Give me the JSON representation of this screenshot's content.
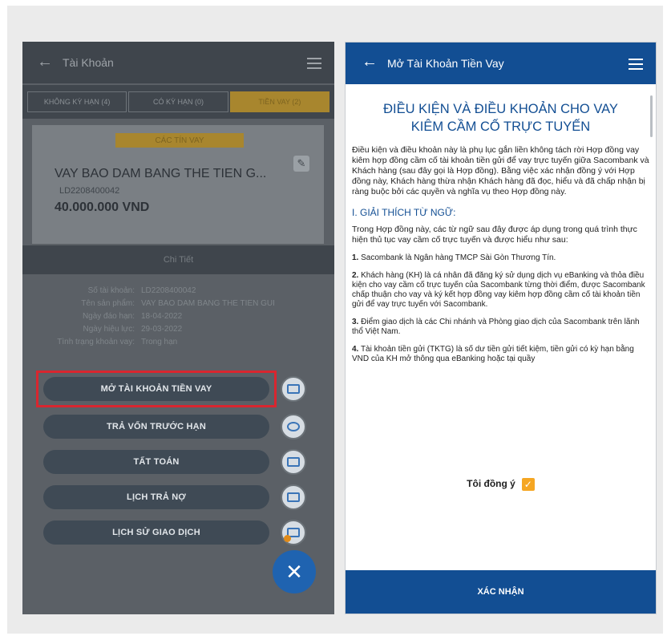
{
  "left": {
    "title": "Tài Khoản",
    "tabs": [
      "KHÔNG KỲ HẠN (4)",
      "CÓ KỲ HẠN (0)",
      "TIỀN VAY (2)"
    ],
    "card": {
      "badge": "CÁC TÍN VAY",
      "name": "VAY BAO DAM BANG THE TIEN G...",
      "account": "LD2208400042",
      "amount": "40.000.000 VND"
    },
    "detail_label": "Chi Tiết",
    "info": [
      {
        "k": "Số tài khoản:",
        "v": "LD2208400042"
      },
      {
        "k": "Tên sản phẩm:",
        "v": "VAY BAO DAM BANG THE TIEN GUI"
      },
      {
        "k": "Ngày đáo hạn:",
        "v": "18-04-2022"
      },
      {
        "k": "Ngày hiệu lực:",
        "v": "29-03-2022"
      },
      {
        "k": "Tình trạng khoản vay:",
        "v": "Trong hạn"
      }
    ],
    "actions": [
      "MỞ TÀI KHOẢN TIỀN VAY",
      "TRẢ VỐN TRƯỚC HẠN",
      "TẤT TOÁN",
      "LỊCH TRẢ NỢ",
      "LỊCH SỬ GIAO DỊCH"
    ],
    "close_glyph": "✕"
  },
  "right": {
    "title": "Mở Tài Khoản Tiền Vay",
    "heading": "ĐIỀU KIỆN VÀ ĐIỀU KHOẢN CHO VAY KIÊM CẦM CỐ TRỰC TUYẾN",
    "intro": "Điều kiện và điều khoản này là phụ lục gắn liền không tách rời Hợp đồng vay kiêm hợp đồng cầm cố tài khoản tiền gửi để vay trực tuyến giữa Sacombank và Khách hàng (sau đây gọi là Hợp đồng). Bằng việc xác nhận đồng ý với Hợp đồng này, Khách hàng thừa nhận Khách hàng đã đọc, hiểu và đã chấp nhận bị ràng buộc bởi các quyền và nghĩa vụ theo Hợp đồng này.",
    "section_title": "I. GIẢI THÍCH TỪ NGỮ:",
    "section_intro": "Trong Hợp đồng này, các từ ngữ sau đây được áp dụng trong quá trình thực hiện thủ tục vay cầm cố trực tuyến và được hiểu như sau:",
    "items": [
      {
        "num": "1.",
        "text": "Sacombank là Ngân hàng TMCP Sài Gòn Thương Tín."
      },
      {
        "num": "2.",
        "text": "Khách hàng (KH) là cá nhân đã đăng ký sử dụng dịch vụ eBanking và thỏa điều kiện cho vay cầm cố trực tuyến của Sacombank từng thời điểm, được Sacombank chấp thuận cho vay và ký kết hợp đồng vay kiêm hợp đồng cầm cố tài khoản tiền gửi để vay trực tuyến với Sacombank."
      },
      {
        "num": "3.",
        "text": "Điểm giao dịch là các Chi nhánh và Phòng giao dịch của Sacombank trên lãnh thổ Việt Nam."
      },
      {
        "num": "4.",
        "text": "Tài khoản tiền gửi (TKTG) là số dư tiền gửi tiết kiệm, tiền gửi có kỳ hạn bằng VND của KH mở thông qua eBanking hoặc tại quầy"
      }
    ],
    "agree_label": "Tôi đồng ý",
    "check_glyph": "✓",
    "confirm_label": "XÁC NHẬN"
  }
}
